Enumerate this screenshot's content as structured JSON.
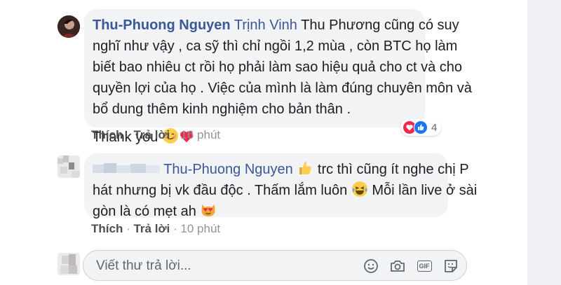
{
  "comment1": {
    "author": "Thu-Phuong Nguyen",
    "tagged": "Trịnh Vinh",
    "lines": [
      "Thu Phương cũng có suy",
      "nghĩ như vậy , ca sỹ thì chỉ ngồi 1,2 mùa , còn BTC họ làm",
      "biết bao nhiêu ct rồi họ phải làm sao hiệu quả cho ct và cho",
      "quyền lợi của họ . Việc của mình là làm đúng chuyên môn và",
      "bổ dung thêm kinh nghiệm cho bản thân ."
    ],
    "thanks": "Thank you",
    "like": "Thích",
    "reply": "Trả lời",
    "sep": "·",
    "time": "16 phút",
    "reaction_count": "4",
    "reaction_icons": [
      "love-icon",
      "like-icon"
    ],
    "emojis": [
      "smiling-face-icon",
      "heart-icon"
    ]
  },
  "comment2": {
    "tagged": "Thu-Phuong Nguyen",
    "line1_rest": "trc thì cũng ít nghe chị P",
    "line2_a": "hát nhưng bị vk đầu độc . Thấm lắm luôn",
    "line2_b": "Mỗi lần live ở sài",
    "line3": "gòn là có mẹt ah",
    "like": "Thích",
    "reply": "Trả lời",
    "sep": "·",
    "time": "10 phút",
    "emojis": [
      "thumbs-up-icon",
      "laughing-tears-icon",
      "heart-eyes-cat-icon"
    ]
  },
  "reply_box": {
    "placeholder": "Viết thư trả lời...",
    "icons": [
      "emoji-icon",
      "camera-icon",
      "gif-icon",
      "sticker-icon"
    ],
    "gif_label": "GIF"
  },
  "colors": {
    "name": "#385898",
    "bubble": "#f2f3f5",
    "meta": "#90949c",
    "love": "#f0284a",
    "like": "#1877f2"
  }
}
